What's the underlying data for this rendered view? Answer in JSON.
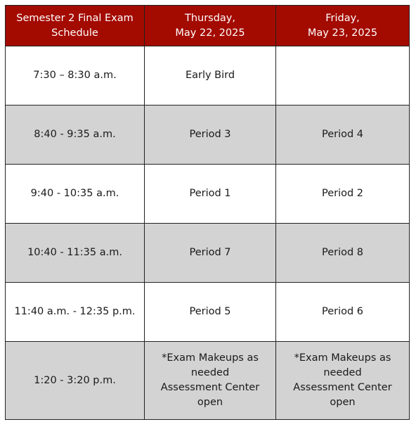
{
  "table": {
    "header": {
      "title": "Semester 2 Final Exam\nSchedule",
      "day1": "Thursday,\nMay 22, 2025",
      "day2": "Friday,\nMay 23, 2025"
    },
    "colors": {
      "header_bg": "#a30a00",
      "header_text": "#ffffff",
      "row_white": "#ffffff",
      "row_gray": "#d3d3d3"
    },
    "rows": [
      {
        "time": "7:30 – 8:30 a.m.",
        "day1": "Early Bird",
        "day2": ""
      },
      {
        "time": "8:40 - 9:35 a.m.",
        "day1": "Period 3",
        "day2": "Period 4"
      },
      {
        "time": "9:40 - 10:35 a.m.",
        "day1": "Period 1",
        "day2": "Period 2"
      },
      {
        "time": "10:40 - 11:35 a.m.",
        "day1": "Period 7",
        "day2": "Period 8"
      },
      {
        "time": "11:40 a.m. - 12:35 p.m.",
        "day1": "Period 5",
        "day2": "Period 6"
      },
      {
        "time": "1:20 - 3:20 p.m.",
        "day1_lines": [
          "*Exam Makeups as",
          "needed",
          "Assessment Center open"
        ],
        "day2_lines": [
          "*Exam Makeups as",
          "needed",
          "Assessment Center open"
        ]
      }
    ]
  }
}
